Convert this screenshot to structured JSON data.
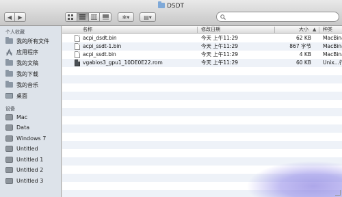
{
  "window": {
    "title": "DSDT"
  },
  "toolbar": {
    "back_glyph": "◀",
    "forward_glyph": "▶",
    "views": [
      "icon-view-icon",
      "list-view-icon",
      "column-view-icon",
      "coverflow-view-icon"
    ],
    "action_glyph": "✻▾",
    "arrange_glyph": "▤▾",
    "search_placeholder": ""
  },
  "sidebar": {
    "favorites_header": "个人收藏",
    "favorites": [
      {
        "label": "我的所有文件",
        "icon": "all-files-icon"
      },
      {
        "label": "应用程序",
        "icon": "applications-icon"
      },
      {
        "label": "我的文稿",
        "icon": "documents-folder-icon"
      },
      {
        "label": "我的下载",
        "icon": "downloads-folder-icon"
      },
      {
        "label": "我的音乐",
        "icon": "music-folder-icon"
      },
      {
        "label": "桌面",
        "icon": "desktop-icon"
      }
    ],
    "devices_header": "设备",
    "devices": [
      {
        "label": "Mac",
        "icon": "disk-icon"
      },
      {
        "label": "Data",
        "icon": "disk-icon"
      },
      {
        "label": "Windows 7",
        "icon": "disk-icon"
      },
      {
        "label": "Untitled",
        "icon": "disk-icon"
      },
      {
        "label": "Untitled 1",
        "icon": "disk-icon"
      },
      {
        "label": "Untitled 2",
        "icon": "disk-icon"
      },
      {
        "label": "Untitled 3",
        "icon": "disk-icon"
      }
    ]
  },
  "list": {
    "columns": {
      "name": "名称",
      "modified": "修改日期",
      "size": "大小",
      "kind": "种类"
    },
    "files": [
      {
        "name": "acpi_dsdt.bin",
        "modified": "今天 上午11:29",
        "size": "62 KB",
        "kind": "MacBinar"
      },
      {
        "name": "acpi_ssdt-1.bin",
        "modified": "今天 上午11:29",
        "size": "867 字节",
        "kind": "MacBinar"
      },
      {
        "name": "acpi_ssdt.bin",
        "modified": "今天 上午11:29",
        "size": "4 KB",
        "kind": "MacBinar"
      },
      {
        "name": "vgabios3_gpu1_10DE0E22.rom",
        "modified": "今天 上午11:29",
        "size": "60 KB",
        "kind": "Unix...行"
      }
    ]
  },
  "colors": {
    "sidebar_bg": "#dde3ea",
    "row_stripe": "#eef2f8"
  }
}
